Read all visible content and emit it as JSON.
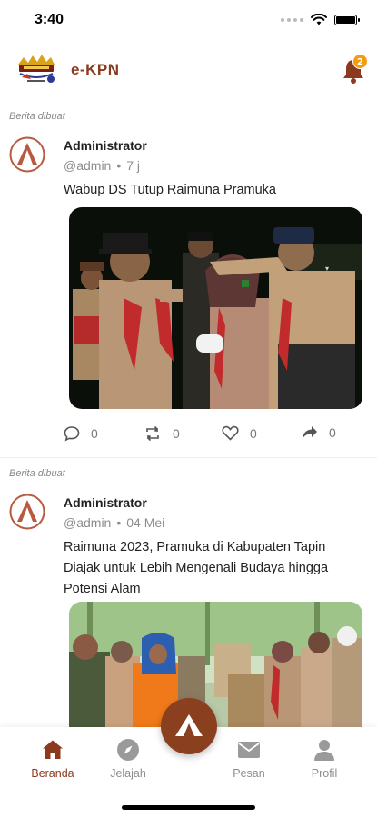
{
  "status_bar": {
    "time": "3:40"
  },
  "header": {
    "title": "e-KPN",
    "notification_count": "2"
  },
  "posts": [
    {
      "meta": "Berita dibuat",
      "author": "Administrator",
      "handle": "@admin",
      "time": "7 j",
      "text": "Wabup DS Tutup Raimuna Pramuka",
      "comments": "0",
      "reposts": "0",
      "likes": "0",
      "shares": "0"
    },
    {
      "meta": "Berita dibuat",
      "author": "Administrator",
      "handle": "@admin",
      "time": "04 Mei",
      "text": "Raimuna 2023, Pramuka di Kabupaten Tapin Diajak untuk Lebih Mengenali Budaya hingga Potensi Alam"
    }
  ],
  "bottom_nav": {
    "items": [
      {
        "label": "Beranda",
        "icon": "home-icon"
      },
      {
        "label": "Jelajah",
        "icon": "compass-icon"
      },
      {
        "label": "Pesan",
        "icon": "mail-icon"
      },
      {
        "label": "Profil",
        "icon": "user-icon"
      }
    ]
  },
  "colors": {
    "brand": "#8b3a1e",
    "badge": "#f39c12",
    "muted": "#8d8d8d"
  }
}
